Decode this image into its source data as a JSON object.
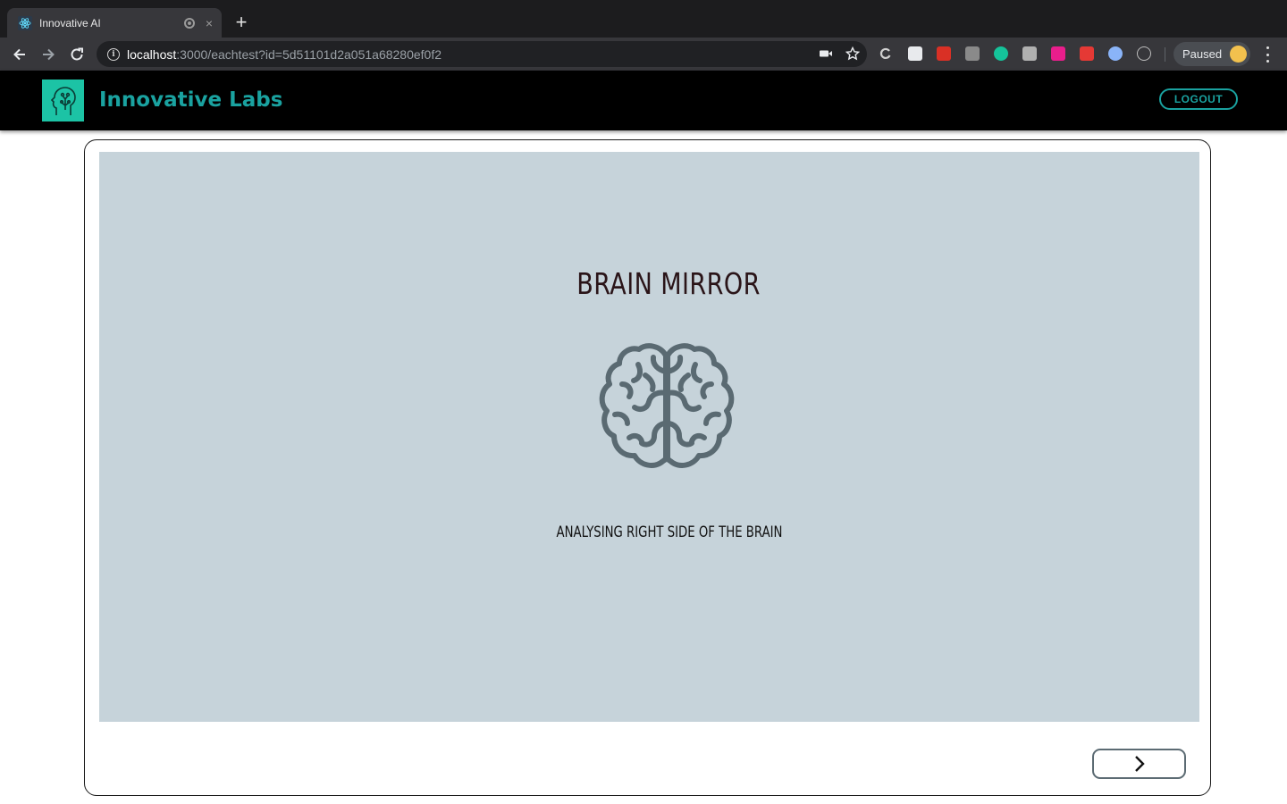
{
  "browser": {
    "tab_title": "Innovative AI",
    "tab_close": "×",
    "new_tab": "+",
    "url_host": "localhost",
    "url_rest": ":3000/eachtest?id=5d51101d2a051a68280ef0f2",
    "profile_label": "Paused"
  },
  "header": {
    "brand": "Innovative Labs",
    "logout_label": "LOGOUT",
    "accent_color": "#1aa2a0",
    "logo_color": "#1cc3a5"
  },
  "test": {
    "title": "BRAIN MIRROR",
    "caption": "ANALYSING RIGHT SIDE OF THE BRAIN",
    "stage_color": "#c6d3da"
  }
}
